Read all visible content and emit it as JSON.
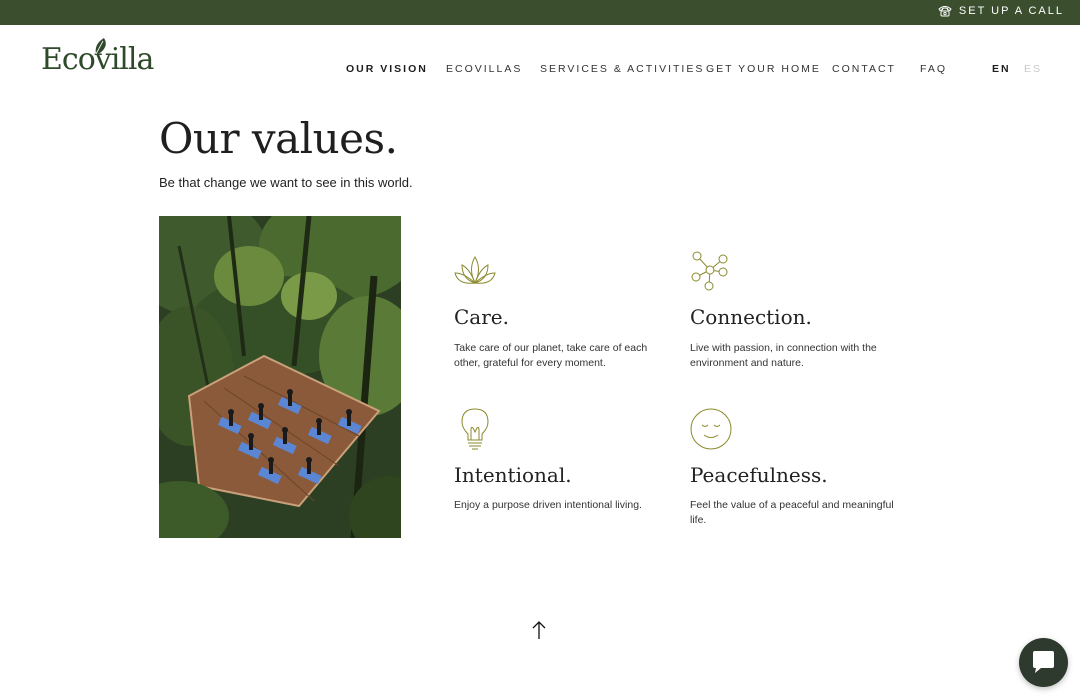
{
  "topbar": {
    "call_label": "SET UP A CALL",
    "call_icon": "phone-icon"
  },
  "logo": {
    "text": "Ecovilla",
    "icon": "leaf-icon"
  },
  "nav": {
    "items": [
      "OUR VISION",
      "ECOVILLAS",
      "SERVICES & ACTIVITIES",
      "GET YOUR HOME",
      "CONTACT",
      "FAQ"
    ],
    "active": "OUR VISION",
    "languages": [
      "EN",
      "ES"
    ],
    "active_language": "EN"
  },
  "main": {
    "title": "Our values.",
    "subtitle": "Be that change we want to see in this world.",
    "photo": {
      "subject": "yoga class on wooden deck in forest canopy"
    },
    "values": [
      {
        "icon": "lotus-icon",
        "title": "Care.",
        "text": "Take care of our planet, take care of each other, grateful for every moment."
      },
      {
        "icon": "network-icon",
        "title": "Connection.",
        "text": "Live with passion, in connection with the environment and nature."
      },
      {
        "icon": "lightbulb-icon",
        "title": "Intentional.",
        "text": "Enjoy a purpose driven intentional living."
      },
      {
        "icon": "smiley-icon",
        "title": "Peacefulness.",
        "text": "Feel the value of a peaceful and meaningful life."
      }
    ]
  },
  "footer": {
    "scroll_icon": "arrow-up-icon",
    "chat_icon": "chat-icon"
  },
  "colors": {
    "topbar": "#3b4f2f",
    "accent": "#8a8a2e",
    "chat": "#2e3a2e"
  }
}
